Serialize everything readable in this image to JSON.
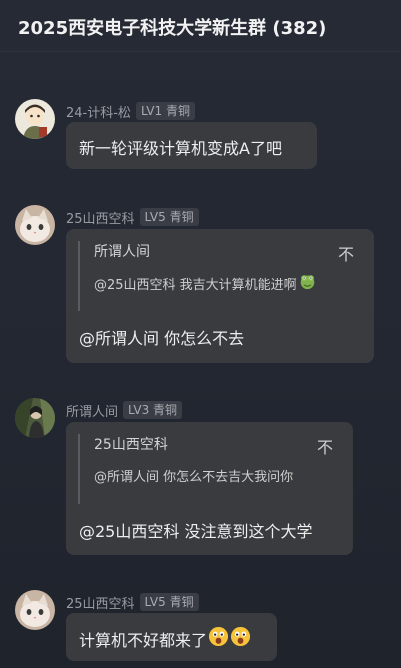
{
  "header": {
    "title": "2025西安电子科技大学新生群 (382)"
  },
  "messages": [
    {
      "sender": "24-计科-松",
      "level": "LV1 青铜",
      "text": "新一轮评级计算机变成A了吧"
    },
    {
      "sender": "25山西空科",
      "level": "LV5 青铜",
      "quote": {
        "author": "所谓人间",
        "icon": "不",
        "text": "@25山西空科 我吉大计算机能进啊",
        "emoji": "frog-emoji"
      },
      "text": "@所谓人间 你怎么不去"
    },
    {
      "sender": "所谓人间",
      "level": "LV3 青铜",
      "quote": {
        "author": "25山西空科",
        "icon": "不",
        "text": "@所谓人间 你怎么不去吉大我问你"
      },
      "text": "@25山西空科 没注意到这个大学"
    },
    {
      "sender": "25山西空科",
      "level": "LV5 青铜",
      "text": "计算机不好都来了",
      "emojis": [
        "astonished-emoji",
        "astonished-emoji"
      ]
    }
  ]
}
